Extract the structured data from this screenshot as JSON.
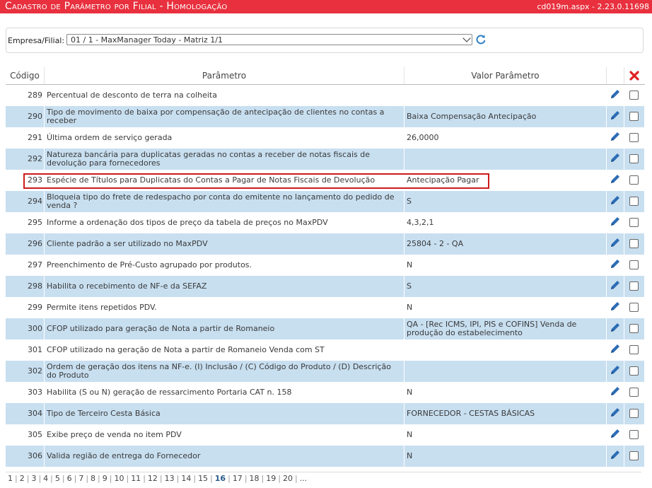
{
  "window": {
    "title": "Cadastro de Parâmetro por Filial  - Homologação",
    "version": "cd019m.aspx - 2.23.0.11698"
  },
  "filter": {
    "label": "Empresa/Filial:",
    "selected": "01 / 1 - MaxManager Today - Matriz 1/1"
  },
  "table": {
    "headers": {
      "code": "Código",
      "param": "Parâmetro",
      "value": "Valor Parâmetro"
    },
    "rows": [
      {
        "code": "289",
        "param": "Percentual de desconto de terra na colheita",
        "value": ""
      },
      {
        "code": "290",
        "param": "Tipo de movimento de baixa por compensação de antecipação de clientes no contas a receber",
        "value": "Baixa Compensação Antecipação"
      },
      {
        "code": "291",
        "param": "Última ordem de serviço gerada",
        "value": "26,0000"
      },
      {
        "code": "292",
        "param": "Natureza bancária para duplicatas geradas no contas a receber de notas fiscais de devolução para fornecedores",
        "value": ""
      },
      {
        "code": "293",
        "param": "Espécie de Títulos para Duplicatas do Contas a Pagar de Notas Fiscais de Devolução",
        "value": "Antecipação Pagar"
      },
      {
        "code": "294",
        "param": "Bloqueia tipo do frete de redespacho por conta do emitente no lançamento do pedido de venda ?",
        "value": "S"
      },
      {
        "code": "295",
        "param": "Informe a ordenação dos tipos de preço da tabela de preços no MaxPDV",
        "value": "4,3,2,1"
      },
      {
        "code": "296",
        "param": "Cliente padrão a ser utilizado no MaxPDV",
        "value": "25804 - 2 - QA"
      },
      {
        "code": "297",
        "param": "Preenchimento de Pré-Custo agrupado por produtos.",
        "value": "N"
      },
      {
        "code": "298",
        "param": "Habilita o recebimento de NF-e da SEFAZ",
        "value": "S"
      },
      {
        "code": "299",
        "param": "Permite itens repetidos PDV.",
        "value": "N"
      },
      {
        "code": "300",
        "param": "CFOP utilizado para geração de Nota a partir de Romaneio",
        "value": "QA - [Rec ICMS, IPI, PIS e COFINS] Venda de produção do estabelecimento"
      },
      {
        "code": "301",
        "param": "CFOP utilizado na geração de Nota a partir de Romaneio Venda com ST",
        "value": ""
      },
      {
        "code": "302",
        "param": "Ordem de geração dos itens na NF-e. (I) Inclusão / (C) Código do Produto / (D) Descrição do Produto",
        "value": ""
      },
      {
        "code": "303",
        "param": "Habilita (S ou N) geração de ressarcimento Portaria CAT n. 158",
        "value": "N"
      },
      {
        "code": "304",
        "param": "Tipo de Terceiro Cesta Básica",
        "value": "FORNECEDOR - CESTAS BÁSICAS"
      },
      {
        "code": "305",
        "param": "Exibe preço de venda no item PDV",
        "value": "N"
      },
      {
        "code": "306",
        "param": "Valida região de entrega do Fornecedor",
        "value": "N"
      }
    ]
  },
  "pager": {
    "pages": [
      "1",
      "2",
      "3",
      "4",
      "5",
      "6",
      "7",
      "8",
      "9",
      "10",
      "11",
      "12",
      "13",
      "14",
      "15",
      "16",
      "17",
      "18",
      "19",
      "20",
      "..."
    ],
    "current": "16"
  },
  "colors": {
    "titlebar": "#e8303e",
    "row_alt": "#c8dff0",
    "edit_icon": "#2d6db5",
    "delete_icon": "#e02020",
    "highlight_border": "#cc1b1b"
  },
  "icons": {
    "refresh": "refresh-icon",
    "edit": "pencil-icon",
    "delete_all": "delete-x-icon"
  }
}
